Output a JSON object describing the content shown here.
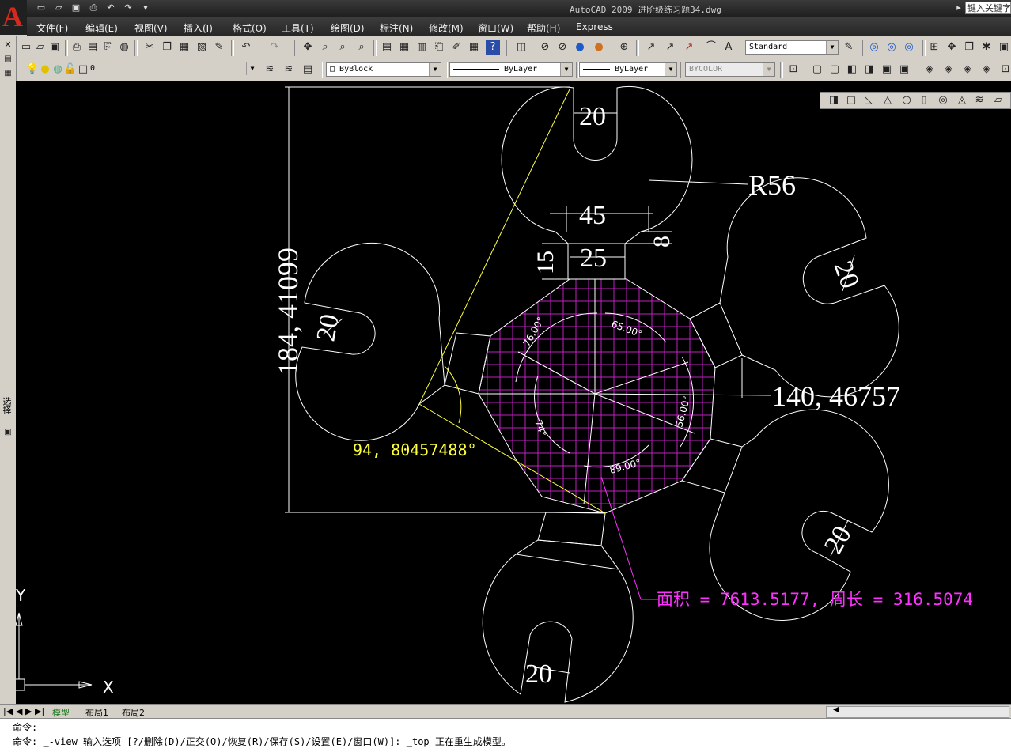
{
  "app": {
    "title": "AutoCAD 2009  进阶级练习题34.dwg",
    "search_placeholder": "键入关键字"
  },
  "menu": [
    "文件(F)",
    "编辑(E)",
    "视图(V)",
    "插入(I)",
    "格式(O)",
    "工具(T)",
    "绘图(D)",
    "标注(N)",
    "修改(M)",
    "窗口(W)",
    "帮助(H)",
    "Express"
  ],
  "toolbar": {
    "text_style": "Standard"
  },
  "properties": {
    "layer": "0",
    "color": "ByBlock",
    "linetype": "ByLayer",
    "lineweight": "ByLayer",
    "plotstyle": "BYCOLOR"
  },
  "left_panel": {
    "label": "选择"
  },
  "drawing": {
    "dims": {
      "top_slot": "20",
      "radius": "R56",
      "neck_width": "45",
      "neck_small": "8",
      "neck_height": "15",
      "neck_base": "25",
      "left_slot": "20",
      "right_upper_slot": "20",
      "right_lower_slot": "20",
      "bottom_slot": "20",
      "height_measure": "184, 41099",
      "width_measure": "140, 46757",
      "angle_measure": "94, 80457488°",
      "area_perimeter": "面积 = 7613.5177, 周长 = 316.5074"
    },
    "angles": {
      "a1": "76.00°",
      "a2": "65.00°",
      "a3": "56.00°",
      "a4": "89.00°",
      "a5": "74°"
    },
    "ucs": {
      "x_label": "X",
      "y_label": "Y"
    }
  },
  "tabs": [
    "模型",
    "布局1",
    "布局2"
  ],
  "command": {
    "line1": "命令:",
    "line2": "命令: _-view 输入选项 [?/删除(D)/正交(O)/恢复(R)/保存(S)/设置(E)/窗口(W)]: _top 正在重生成模型。"
  },
  "colors": {
    "canvas": "#000000",
    "geometry": "#ffffff",
    "hatch": "#c020c0",
    "area_text": "#ff30ff",
    "angle_text": "#ffff40"
  }
}
